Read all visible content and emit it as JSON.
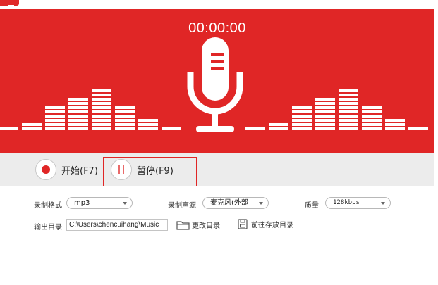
{
  "app": {
    "badge_icon": "app-logo-icon",
    "accent": "#e02626"
  },
  "timer": "00:00:00",
  "controls": {
    "start_label": "开始(F7)",
    "pause_label": "暂停(F9)"
  },
  "settings": {
    "format_label": "录制格式",
    "format_value": "mp3",
    "source_label": "录制声源",
    "source_value": "麦克风(外部",
    "quality_label": "质量",
    "quality_value": "128kbps",
    "output_label": "输出目录",
    "output_path": "C:\\Users\\chencuihang\\Music",
    "change_dir_label": "更改目录",
    "open_dir_label": "前往存放目录"
  },
  "icons": {
    "mic": "microphone-icon",
    "record": "record-icon",
    "pause": "pause-icon",
    "folder": "folder-icon",
    "save": "save-icon"
  }
}
